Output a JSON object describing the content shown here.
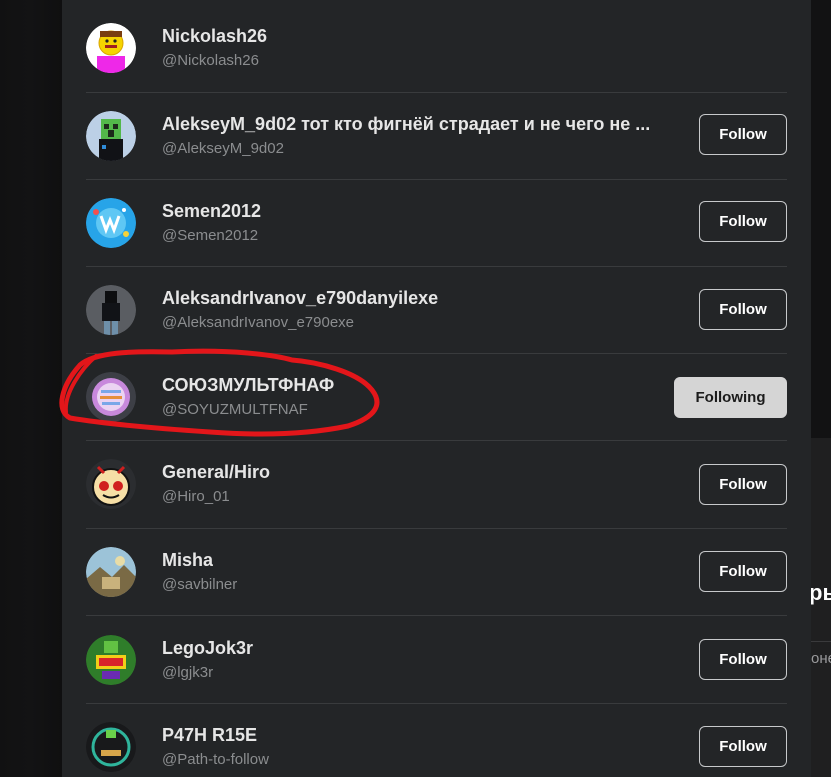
{
  "users": [
    {
      "name": "Nickolash26",
      "handle": "@Nickolash26",
      "button": "",
      "state": "none",
      "avatar": "pink-figure-avatar"
    },
    {
      "name": "AlekseyM_9d02 тот кто фигнёй страдает и не чего не ...",
      "handle": "@AlekseyM_9d02",
      "button": "Follow",
      "state": "follow",
      "avatar": "creeper-avatar"
    },
    {
      "name": "Semen2012",
      "handle": "@Semen2012",
      "button": "Follow",
      "state": "follow",
      "avatar": "vk-logo-avatar"
    },
    {
      "name": "AleksandrIvanov_e790danyilexe",
      "handle": "@AleksandrIvanov_e790exe",
      "button": "Follow",
      "state": "follow",
      "avatar": "dark-figure-avatar"
    },
    {
      "name": "СОЮЗМУЛЬТФНАФ",
      "handle": "@SOYUZMULTFNAF",
      "button": "Following",
      "state": "following",
      "avatar": "soyuzmult-badge-avatar"
    },
    {
      "name": "General/Hiro",
      "handle": "@Hiro_01",
      "button": "Follow",
      "state": "follow",
      "avatar": "hiro-face-avatar"
    },
    {
      "name": "Misha",
      "handle": "@savbilner",
      "button": "Follow",
      "state": "follow",
      "avatar": "landscape-avatar"
    },
    {
      "name": "LegoJok3r",
      "handle": "@lgjk3r",
      "button": "Follow",
      "state": "follow",
      "avatar": "lego-joker-avatar"
    },
    {
      "name": "P47H R15E",
      "handle": "@Path-to-follow",
      "button": "Follow",
      "state": "follow",
      "avatar": "dark-circle-avatar"
    }
  ],
  "background_fragments": {
    "heading": "ры",
    "subtext": "оне"
  },
  "colors": {
    "panel": "#232527",
    "divider": "#393b3d",
    "name": "#e6e6e6",
    "handle": "#8b8d8f",
    "following_bg": "#d5d5d5",
    "annotation": "#e3161a"
  }
}
